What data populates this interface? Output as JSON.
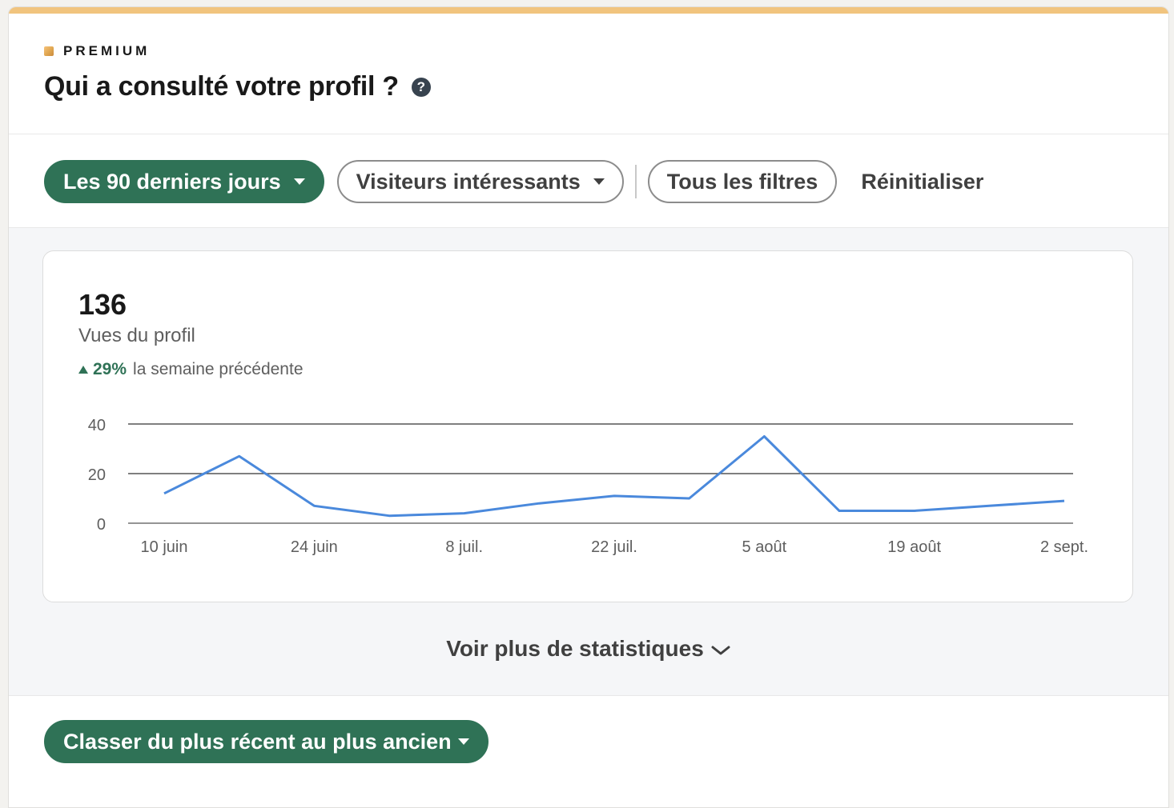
{
  "header": {
    "premium_label": "PREMIUM",
    "title": "Qui a consulté votre profil ?",
    "help_glyph": "?"
  },
  "filters": {
    "period_label": "Les 90 derniers jours",
    "visitors_label": "Visiteurs intéressants",
    "all_filters_label": "Tous les filtres",
    "reset_label": "Réinitialiser"
  },
  "stats": {
    "views_count": "136",
    "views_label": "Vues du profil",
    "trend_value": "29%",
    "trend_label": "la semaine précédente",
    "see_more_label": "Voir plus de statistiques"
  },
  "sort": {
    "label": "Classer du plus récent au plus ancien"
  },
  "colors": {
    "accent": "#2f7256",
    "line": "#4a89dc",
    "premium_gold": "#f1c47e"
  },
  "chart_data": {
    "type": "line",
    "x": [
      "10 juin",
      "17 juin",
      "24 juin",
      "1 juil.",
      "8 juil.",
      "15 juil.",
      "22 juil.",
      "29 juil.",
      "5 août",
      "12 août",
      "19 août",
      "26 août",
      "2 sept."
    ],
    "tick_labels": [
      "10 juin",
      "24 juin",
      "8 juil.",
      "22 juil.",
      "5 août",
      "19 août",
      "2 sept."
    ],
    "series": [
      {
        "values": [
          12,
          27,
          7,
          3,
          4,
          8,
          11,
          10,
          35,
          5,
          5,
          7,
          9
        ]
      }
    ],
    "yticks": [
      0,
      20,
      40
    ],
    "ylim": [
      0,
      40
    ],
    "grid": true
  }
}
